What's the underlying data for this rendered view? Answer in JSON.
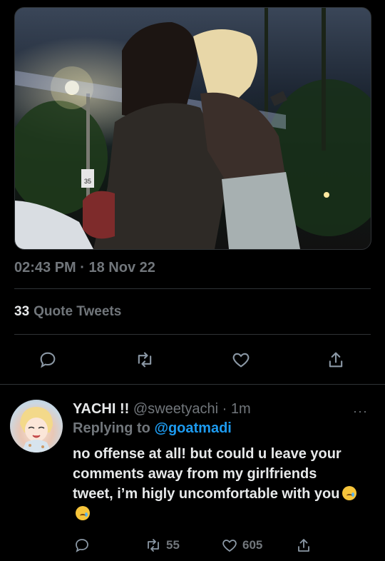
{
  "tweet": {
    "timestamp": "02:43 PM · 18 Nov 22",
    "quote_count": "33",
    "quote_label": "Quote Tweets",
    "media": {
      "sign_text": "35"
    }
  },
  "reply": {
    "display_name": "YACHI !!",
    "handle": "@sweetyachi",
    "time": "· 1m",
    "more": "···",
    "replying_prefix": "Replying to",
    "replying_to": "@goatmadi",
    "text": "no offense at all! but could u leave your comments away from my girlfriends tweet, i’m higly uncomfortable with you",
    "emoji": [
      "crying-face",
      "crying-face"
    ],
    "retweets": "55",
    "likes": "605"
  },
  "colors": {
    "accent": "#1d9bf0",
    "muted": "#71767b",
    "text": "#e7e9ea",
    "background": "#000000"
  }
}
